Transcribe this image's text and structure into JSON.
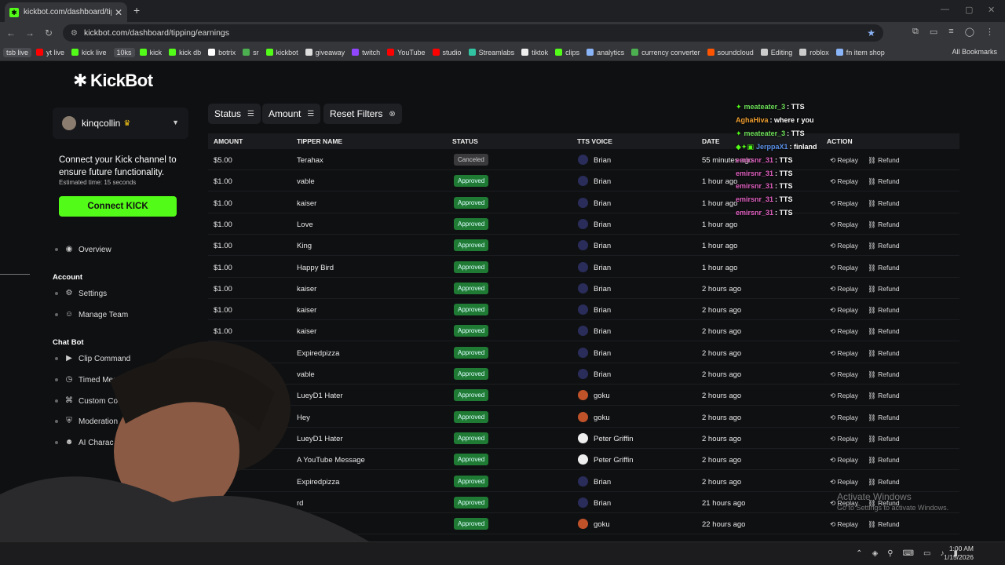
{
  "browser": {
    "tab_title": "kickbot.com/dashboard/tipping",
    "url": "kickbot.com/dashboard/tipping/earnings",
    "bookmarks": [
      {
        "label": "tsb live",
        "color": "#888",
        "pill": true
      },
      {
        "label": "yt live",
        "color": "#ff0000",
        "pill": false
      },
      {
        "label": "kick live",
        "color": "#53fc18",
        "pill": false
      },
      {
        "label": "10ks",
        "color": "#888",
        "pill": true
      },
      {
        "label": "kick",
        "color": "#53fc18",
        "pill": false
      },
      {
        "label": "kick db",
        "color": "#53fc18",
        "pill": false
      },
      {
        "label": "botrix",
        "color": "#fff",
        "pill": false
      },
      {
        "label": "sr",
        "color": "#4caf50",
        "pill": false
      },
      {
        "label": "kickbot",
        "color": "#53fc18",
        "pill": false
      },
      {
        "label": "giveaway",
        "color": "#ddd",
        "pill": false
      },
      {
        "label": "twitch",
        "color": "#9146ff",
        "pill": false
      },
      {
        "label": "YouTube",
        "color": "#ff0000",
        "pill": false
      },
      {
        "label": "studio",
        "color": "#ff0000",
        "pill": false
      },
      {
        "label": "Streamlabs",
        "color": "#31c3a2",
        "pill": false
      },
      {
        "label": "tiktok",
        "color": "#eee",
        "pill": false
      },
      {
        "label": "clips",
        "color": "#53fc18",
        "pill": false
      },
      {
        "label": "analytics",
        "color": "#8ab4f8",
        "pill": false
      },
      {
        "label": "currency converter",
        "color": "#4caf50",
        "pill": false
      },
      {
        "label": "soundcloud",
        "color": "#ff5500",
        "pill": false
      },
      {
        "label": "Editing",
        "color": "#ccc",
        "pill": false
      },
      {
        "label": "roblox",
        "color": "#ccc",
        "pill": false
      },
      {
        "label": "fn item shop",
        "color": "#8ab4f8",
        "pill": false
      }
    ],
    "all_bookmarks": "All Bookmarks"
  },
  "app": {
    "logo": "KickBot",
    "username": "kinqcollin",
    "connect": {
      "heading": "Connect your Kick channel to ensure future functionality.",
      "estimate": "Estimated time: 15 seconds",
      "button": "Connect KICK"
    },
    "nav": {
      "overview": "Overview",
      "account_section": "Account",
      "settings": "Settings",
      "manage_team": "Manage Team",
      "chatbot_section": "Chat Bot",
      "clip_command": "Clip Command",
      "timed_messages": "Timed Message",
      "custom_commands": "Custom Comm",
      "moderation": "Moderation",
      "ai_characters": "AI Charac"
    },
    "filters": {
      "status": "Status",
      "amount": "Amount",
      "reset": "Reset Filters"
    },
    "table": {
      "headers": {
        "amount": "AMOUNT",
        "tipper": "TIPPER NAME",
        "status": "STATUS",
        "voice": "TTS VOICE",
        "date": "DATE",
        "action": "ACTION"
      },
      "replay_label": "Replay",
      "refund_label": "Refund",
      "rows": [
        {
          "amount": "$5.00",
          "tipper": "Terahax",
          "status": "Canceled",
          "voice": "Brian",
          "date": "55 minutes ago",
          "vcolor": "#2a2d5a"
        },
        {
          "amount": "$1.00",
          "tipper": "vable",
          "status": "Approved",
          "voice": "Brian",
          "date": "1 hour ago",
          "vcolor": "#2a2d5a"
        },
        {
          "amount": "$1.00",
          "tipper": "kaiser",
          "status": "Approved",
          "voice": "Brian",
          "date": "1 hour ago",
          "vcolor": "#2a2d5a"
        },
        {
          "amount": "$1.00",
          "tipper": "Love",
          "status": "Approved",
          "voice": "Brian",
          "date": "1 hour ago",
          "vcolor": "#2a2d5a"
        },
        {
          "amount": "$1.00",
          "tipper": "King",
          "status": "Approved",
          "voice": "Brian",
          "date": "1 hour ago",
          "vcolor": "#2a2d5a"
        },
        {
          "amount": "$1.00",
          "tipper": "Happy Bird",
          "status": "Approved",
          "voice": "Brian",
          "date": "1 hour ago",
          "vcolor": "#2a2d5a"
        },
        {
          "amount": "$1.00",
          "tipper": "kaiser",
          "status": "Approved",
          "voice": "Brian",
          "date": "2 hours ago",
          "vcolor": "#2a2d5a"
        },
        {
          "amount": "$1.00",
          "tipper": "kaiser",
          "status": "Approved",
          "voice": "Brian",
          "date": "2 hours ago",
          "vcolor": "#2a2d5a"
        },
        {
          "amount": "$1.00",
          "tipper": "kaiser",
          "status": "Approved",
          "voice": "Brian",
          "date": "2 hours ago",
          "vcolor": "#2a2d5a"
        },
        {
          "amount": "$",
          "tipper": "Expiredpizza",
          "status": "Approved",
          "voice": "Brian",
          "date": "2 hours ago",
          "vcolor": "#2a2d5a"
        },
        {
          "amount": "",
          "tipper": "vable",
          "status": "Approved",
          "voice": "Brian",
          "date": "2 hours ago",
          "vcolor": "#2a2d5a"
        },
        {
          "amount": "",
          "tipper": "LueyD1 Hater",
          "status": "Approved",
          "voice": "goku",
          "date": "2 hours ago",
          "vcolor": "#c0522a"
        },
        {
          "amount": "",
          "tipper": "Hey",
          "status": "Approved",
          "voice": "goku",
          "date": "2 hours ago",
          "vcolor": "#c0522a"
        },
        {
          "amount": "",
          "tipper": "LueyD1 Hater",
          "status": "Approved",
          "voice": "Peter Griffin",
          "date": "2 hours ago",
          "vcolor": "#eeeeee"
        },
        {
          "amount": "",
          "tipper": "A YouTube Message",
          "status": "Approved",
          "voice": "Peter Griffin",
          "date": "2 hours ago",
          "vcolor": "#eeeeee"
        },
        {
          "amount": "",
          "tipper": "Expiredpizza",
          "status": "Approved",
          "voice": "Brian",
          "date": "2 hours ago",
          "vcolor": "#2a2d5a"
        },
        {
          "amount": "",
          "tipper": "rd",
          "status": "Approved",
          "voice": "Brian",
          "date": "21 hours ago",
          "vcolor": "#2a2d5a"
        },
        {
          "amount": "",
          "tipper": "ater",
          "status": "Approved",
          "voice": "goku",
          "date": "22 hours ago",
          "vcolor": "#c0522a"
        }
      ]
    }
  },
  "chat_overlay": [
    {
      "user": "meateater_3",
      "msg": ": TTS",
      "color": "#6ee05a",
      "badge": "✦"
    },
    {
      "user": "AghaHiva",
      "msg": ": where r you",
      "color": "#f0a030",
      "badge": ""
    },
    {
      "user": "meateater_3",
      "msg": ": TTS",
      "color": "#6ee05a",
      "badge": "✦"
    },
    {
      "user": "JerppaX1",
      "msg": ": finland",
      "color": "#5a8fe8",
      "badge": "◆✦▣"
    },
    {
      "user": "emirsnr_31",
      "msg": ": TTS",
      "color": "#e060c0",
      "badge": ""
    },
    {
      "user": "emirsnr_31",
      "msg": ": TTS",
      "color": "#e060c0",
      "badge": ""
    },
    {
      "user": "emirsnr_31",
      "msg": ": TTS",
      "color": "#e060c0",
      "badge": ""
    },
    {
      "user": "emirsnr_31",
      "msg": ": TTS",
      "color": "#e060c0",
      "badge": ""
    },
    {
      "user": "emirsnr_31",
      "msg": ": TTS",
      "color": "#e060c0",
      "badge": ""
    }
  ],
  "watermark": {
    "line1": "Activate Windows",
    "line2": "Go to Settings to activate Windows."
  },
  "taskbar": {
    "time": "1:00 AM",
    "date": "1/15/2026"
  }
}
